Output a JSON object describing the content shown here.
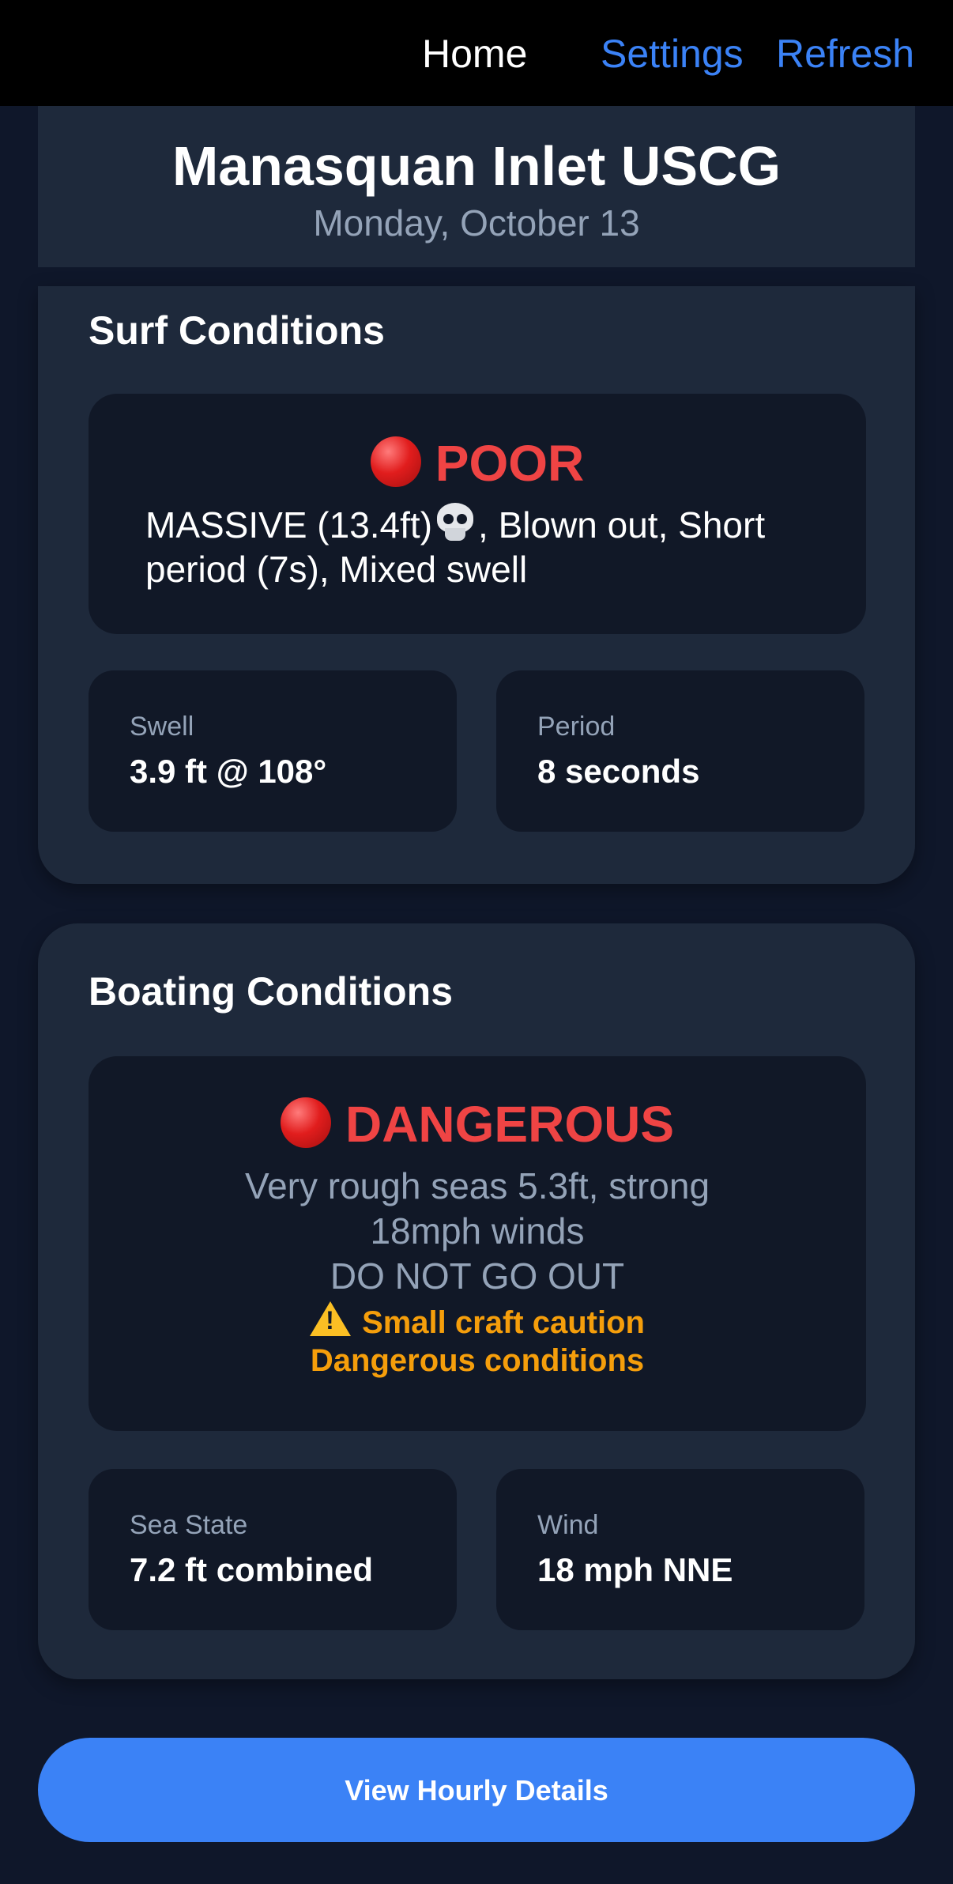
{
  "nav": {
    "home": "Home",
    "settings": "Settings",
    "refresh": "Refresh"
  },
  "header": {
    "location": "Manasquan Inlet USCG",
    "date": "Monday, October 13"
  },
  "surf": {
    "title": "Surf Conditions",
    "rating": "POOR",
    "rating_icon": "red-circle",
    "description_part1": "MASSIVE (13.4ft)",
    "description_icon": "skull",
    "description_part2": ", Blown out, Short period (7s), Mixed swell",
    "stats": [
      {
        "label": "Swell",
        "value": "3.9 ft @ 108°"
      },
      {
        "label": "Period",
        "value": "8 seconds"
      }
    ]
  },
  "boating": {
    "title": "Boating Conditions",
    "rating": "DANGEROUS",
    "rating_icon": "red-circle",
    "description_line1": "Very rough seas 5.3ft, strong",
    "description_line2": "18mph winds",
    "description_line3": "DO NOT GO OUT",
    "warning_icon": "warning",
    "warning_line1": "Small craft caution",
    "warning_line2": "Dangerous conditions",
    "stats": [
      {
        "label": "Sea State",
        "value": "7.2 ft combined"
      },
      {
        "label": "Wind",
        "value": "18 mph NNE"
      }
    ]
  },
  "cta": {
    "label": "View Hourly Details"
  },
  "colors": {
    "background": "#0f172a",
    "card": "#1e293b",
    "inner_box": "#111827",
    "accent": "#3b82f6",
    "danger": "#ef4444",
    "warning": "#f59e0b",
    "muted": "#94a3b8"
  }
}
